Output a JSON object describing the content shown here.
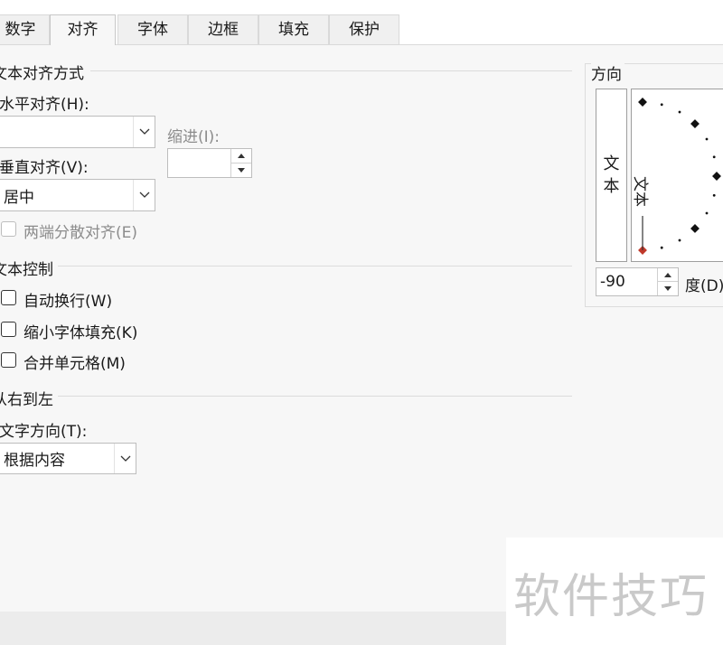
{
  "tabs": [
    {
      "label": "数字"
    },
    {
      "label": "对齐"
    },
    {
      "label": "字体"
    },
    {
      "label": "边框"
    },
    {
      "label": "填充"
    },
    {
      "label": "保护"
    }
  ],
  "active_tab": "对齐",
  "text_alignment": {
    "section_title": "文本对齐方式",
    "horizontal_label": "水平对齐(H):",
    "horizontal_value": "",
    "indent_label": "缩进(I):",
    "indent_value": "",
    "vertical_label": "垂直对齐(V):",
    "vertical_value": "居中",
    "justify_distributed_label": "两端分散对齐(E)"
  },
  "text_control": {
    "section_title": "文本控制",
    "wrap_text_label": "自动换行(W)",
    "shrink_to_fit_label": "缩小字体填充(K)",
    "merge_cells_label": "合并单元格(M)"
  },
  "rtl": {
    "section_title": "从右到左",
    "direction_label": "文字方向(T):",
    "direction_value": "根据内容"
  },
  "orientation": {
    "section_title": "方向",
    "vertical_text": "文本",
    "dial_text": "文本",
    "degrees_value": "-90",
    "degrees_label": "度(D)"
  },
  "watermark": "软件技巧",
  "colors": {
    "dial_active_point": "#c0392b",
    "dial_point": "#111111"
  }
}
